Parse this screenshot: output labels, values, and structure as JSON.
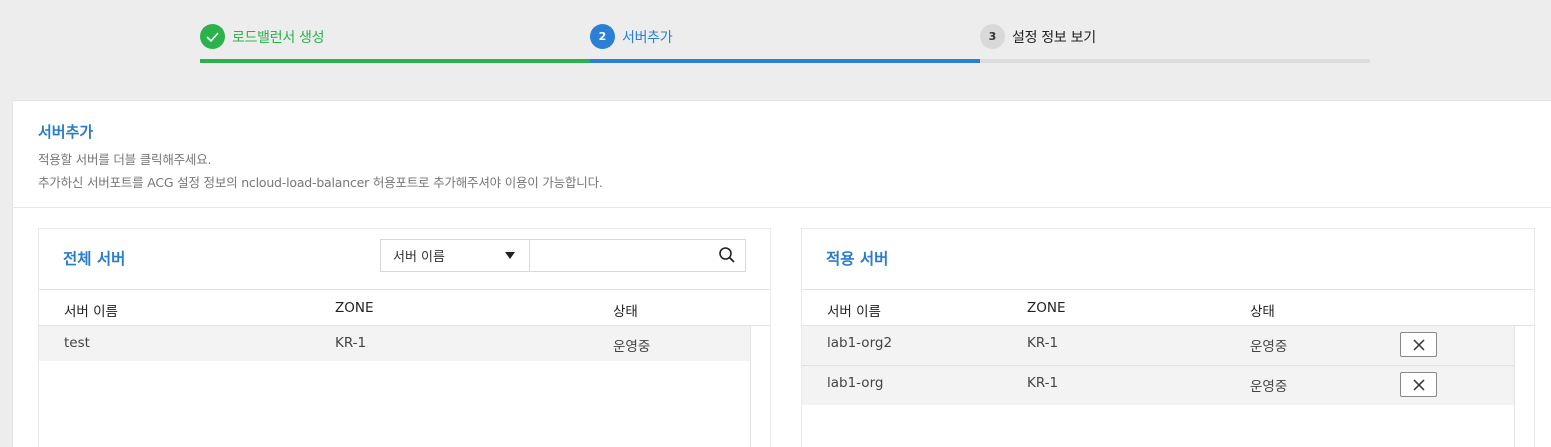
{
  "stepper": {
    "steps": [
      {
        "number": "",
        "label": "로드밸런서 생성",
        "state": "done",
        "icon": "check-icon"
      },
      {
        "number": "2",
        "label": "서버추가",
        "state": "active"
      },
      {
        "number": "3",
        "label": "설정 정보 보기",
        "state": "pending"
      }
    ]
  },
  "section": {
    "title": "서버추가",
    "desc_1": "적용할 서버를 더블 클릭해주세요.",
    "desc_2": "추가하신 서버포트를 ACG 설정 정보의 ncloud-load-balancer 허용포트로 추가해주셔야 이용이 가능합니다."
  },
  "all_servers": {
    "title": "전체 서버",
    "search_field": {
      "selected": "서버 이름",
      "icon": "chevron-down-icon"
    },
    "search_input": {
      "value": "",
      "placeholder": ""
    },
    "search_icon": "search-icon",
    "columns": [
      "서버 이름",
      "ZONE",
      "상태"
    ],
    "rows": [
      {
        "name": "test",
        "zone": "KR-1",
        "status": "운영중"
      }
    ]
  },
  "applied_servers": {
    "title": "적용 서버",
    "columns": [
      "서버 이름",
      "ZONE",
      "상태"
    ],
    "rows": [
      {
        "name": "lab1-org2",
        "zone": "KR-1",
        "status": "운영중"
      },
      {
        "name": "lab1-org",
        "zone": "KR-1",
        "status": "운영중"
      }
    ],
    "remove_icon": "close-icon"
  },
  "colors": {
    "done": "#2bb24c",
    "active": "#2b80d5",
    "title_blue": "#2b7cc9",
    "pending": "#d9d9d9"
  }
}
